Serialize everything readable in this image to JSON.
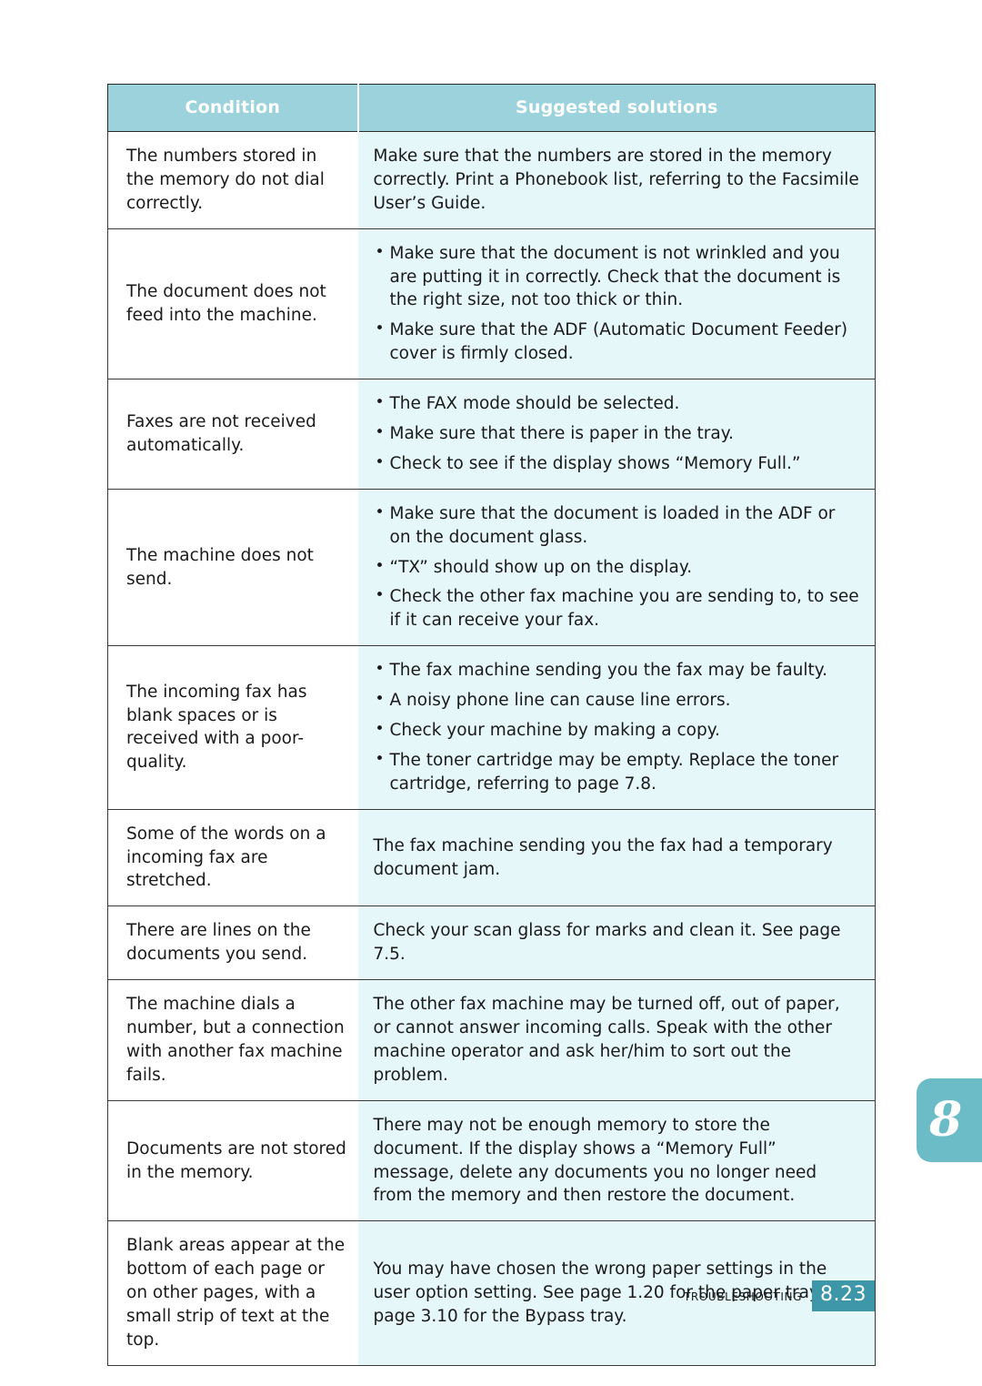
{
  "table": {
    "headers": {
      "condition": "Condition",
      "solutions": "Suggested solutions"
    },
    "rows": [
      {
        "condition": "The numbers stored in the memory do not dial correctly.",
        "solution_type": "paragraph",
        "solution": "Make sure that the numbers are stored in the memory correctly. Print a Phonebook list, referring to the Facsimile User’s Guide."
      },
      {
        "condition": "The document does not feed into the machine.",
        "solution_type": "bullets",
        "bullets": [
          "Make sure that the document is not wrinkled and you are putting it in correctly. Check that the document is the right size, not too thick or thin.",
          "Make sure that the ADF (Automatic Document Feeder) cover is firmly closed."
        ]
      },
      {
        "condition": "Faxes are not received automatically.",
        "solution_type": "bullets",
        "bullets": [
          "The FAX mode should be selected.",
          "Make sure that there is paper in the tray.",
          "Check to see if the display shows “Memory Full.”"
        ]
      },
      {
        "condition": "The machine does not send.",
        "solution_type": "bullets",
        "bullets": [
          "Make sure that the document is loaded in the ADF or on the document glass.",
          "“TX” should show up on the display.",
          "Check the other fax machine you are sending to, to see if it can receive your fax."
        ]
      },
      {
        "condition": "The incoming fax has blank spaces or is received with a poor-quality.",
        "solution_type": "bullets",
        "bullets": [
          "The fax machine sending you the fax may be faulty.",
          "A noisy phone line can cause line errors.",
          "Check your machine by making a copy.",
          "The toner cartridge may be empty. Replace the toner cartridge, referring to page 7.8."
        ]
      },
      {
        "condition": "Some of the words on a incoming fax are stretched.",
        "solution_type": "paragraph",
        "solution": "The fax machine sending you the fax had a temporary document jam."
      },
      {
        "condition": "There are lines on the documents you send.",
        "solution_type": "paragraph",
        "solution": "Check your scan glass for marks and clean it. See page 7.5."
      },
      {
        "condition": "The machine dials a number, but a connection with another fax machine fails.",
        "solution_type": "paragraph",
        "solution": "The other fax machine may be turned off, out of paper, or cannot answer incoming calls. Speak with the other machine operator and ask her/him to sort out the problem."
      },
      {
        "condition": "Documents are not stored in the memory.",
        "solution_type": "paragraph",
        "solution": "There may not be enough memory to store the document. If the display shows a “Memory Full” message, delete any documents you no longer need from the memory and then restore the document."
      },
      {
        "condition": "Blank areas appear at the bottom of each page or on other pages, with a small strip of text at the top.",
        "solution_type": "paragraph",
        "solution": "You may have chosen the wrong paper settings in the user option setting. See page 1.20 for the paper tray and page 3.10 for the Bypass tray."
      }
    ]
  },
  "chapter_tab": {
    "number": "8"
  },
  "footer": {
    "section_label": "Troubleshooting",
    "page_number": "8.23"
  },
  "colors": {
    "header_band": "#9bd2dc",
    "solution_cell": "#e6f7fa",
    "chapter_tab": "#6cbcc8",
    "page_number_box": "#3e96a9",
    "rule": "#3a3a3a"
  }
}
